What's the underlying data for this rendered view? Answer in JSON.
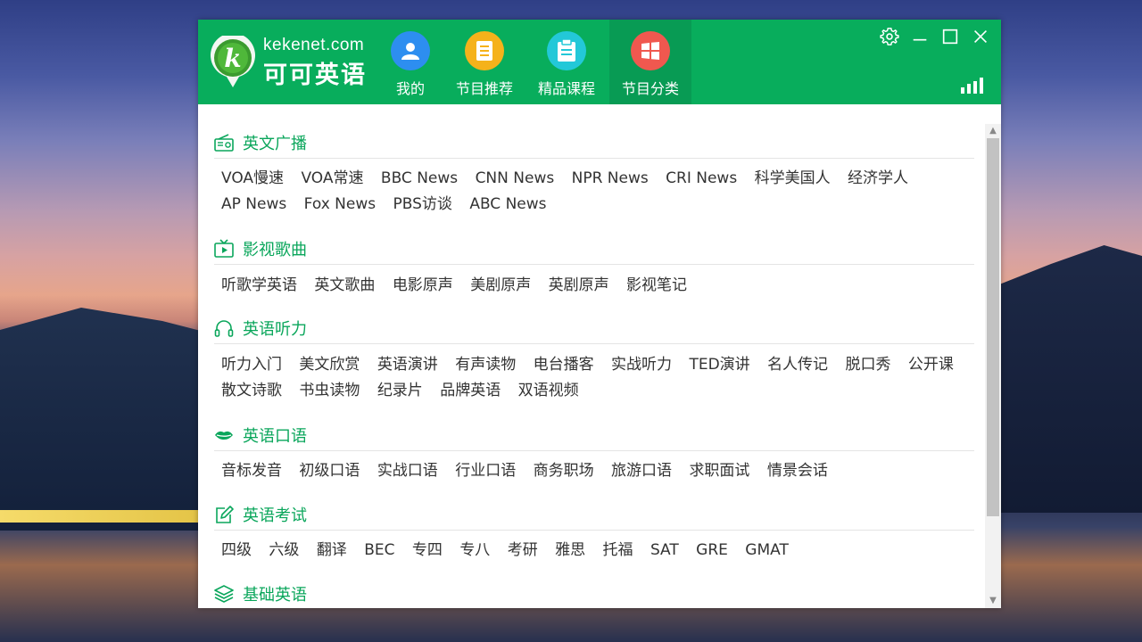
{
  "app": {
    "logo_en": "kekenet.com",
    "logo_zh": "可可英语",
    "accent_color": "#08ad5c"
  },
  "nav": {
    "tabs": [
      {
        "label": "我的",
        "icon": "user-icon",
        "color": "#2d8ef0"
      },
      {
        "label": "节目推荐",
        "icon": "list-icon",
        "color": "#f5b21b"
      },
      {
        "label": "精品课程",
        "icon": "clipboard-icon",
        "color": "#23c8d8"
      },
      {
        "label": "节目分类",
        "icon": "windows-grid-icon",
        "color": "#f0584f",
        "active": true
      }
    ]
  },
  "window_controls": {
    "settings": "gear-icon",
    "minimize": "minimize-icon",
    "maximize": "maximize-icon",
    "close": "close-icon"
  },
  "sections": [
    {
      "title": "英文广播",
      "icon": "radio-icon",
      "items": [
        "VOA慢速",
        "VOA常速",
        "BBC News",
        "CNN News",
        "NPR News",
        "CRI News",
        "科学美国人",
        "经济学人",
        "AP News",
        "Fox News",
        "PBS访谈",
        "ABC News"
      ]
    },
    {
      "title": "影视歌曲",
      "icon": "tv-icon",
      "items": [
        "听歌学英语",
        "英文歌曲",
        "电影原声",
        "美剧原声",
        "英剧原声",
        "影视笔记"
      ]
    },
    {
      "title": "英语听力",
      "icon": "headphones-icon",
      "items": [
        "听力入门",
        "美文欣赏",
        "英语演讲",
        "有声读物",
        "电台播客",
        "实战听力",
        "TED演讲",
        "名人传记",
        "脱口秀",
        "公开课",
        "散文诗歌",
        "书虫读物",
        "纪录片",
        "品牌英语",
        "双语视频"
      ]
    },
    {
      "title": "英语口语",
      "icon": "lips-icon",
      "items": [
        "音标发音",
        "初级口语",
        "实战口语",
        "行业口语",
        "商务职场",
        "旅游口语",
        "求职面试",
        "情景会话"
      ]
    },
    {
      "title": "英语考试",
      "icon": "edit-icon",
      "items": [
        "四级",
        "六级",
        "翻译",
        "BEC",
        "专四",
        "专八",
        "考研",
        "雅思",
        "托福",
        "SAT",
        "GRE",
        "GMAT"
      ]
    },
    {
      "title": "基础英语",
      "icon": "layers-icon",
      "items": []
    }
  ]
}
